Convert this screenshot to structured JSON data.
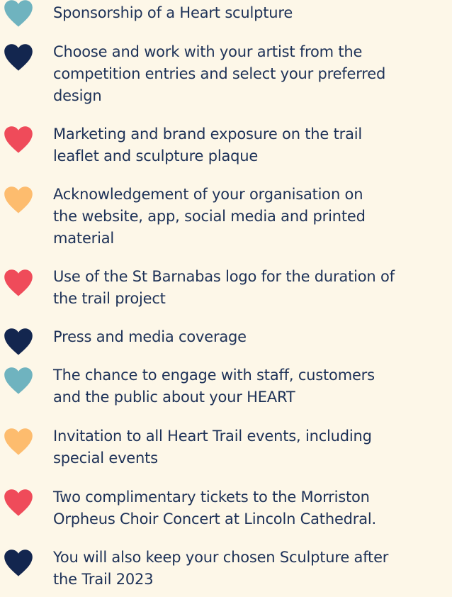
{
  "benefits": [
    {
      "heart_color": "#6fb3bf",
      "icon": "heart-icon",
      "lines": [
        "Sponsorship of a Heart sculpture"
      ]
    },
    {
      "heart_color": "#13264f",
      "icon": "heart-icon",
      "lines": [
        "Choose and work with your artist from the",
        "competition entries and select your preferred",
        "design"
      ]
    },
    {
      "heart_color": "#ef4b5a",
      "icon": "heart-icon",
      "lines": [
        "Marketing and brand exposure on the trail",
        "leaflet and sculpture plaque"
      ]
    },
    {
      "heart_color": "#fdbc6e",
      "icon": "heart-icon",
      "lines": [
        "Acknowledgement of your organisation on",
        "the website, app, social media and printed",
        "material"
      ]
    },
    {
      "heart_color": "#ef4b5a",
      "icon": "heart-icon",
      "lines": [
        "Use of the St Barnabas logo for the duration of",
        "the trail project"
      ]
    },
    {
      "heart_color": "#13264f",
      "icon": "heart-icon",
      "lines": [
        "Press and media coverage"
      ]
    },
    {
      "heart_color": "#6fb3bf",
      "icon": "heart-icon",
      "lines": [
        "The chance to engage with staff, customers",
        "and the public about your HEART"
      ]
    },
    {
      "heart_color": "#fdbc6e",
      "icon": "heart-icon",
      "lines": [
        "Invitation to all Heart Trail events, including",
        "special events"
      ]
    },
    {
      "heart_color": "#ef4b5a",
      "icon": "heart-icon",
      "lines": [
        "Two complimentary tickets to the Morriston",
        "Orpheus Choir Concert at Lincoln Cathedral."
      ]
    },
    {
      "heart_color": "#13264f",
      "icon": "heart-icon",
      "lines": [
        "You will also keep your chosen Sculpture after",
        "the Trail 2023"
      ]
    }
  ],
  "colors": {
    "background": "#fdf7e8",
    "text": "#1d3157"
  }
}
